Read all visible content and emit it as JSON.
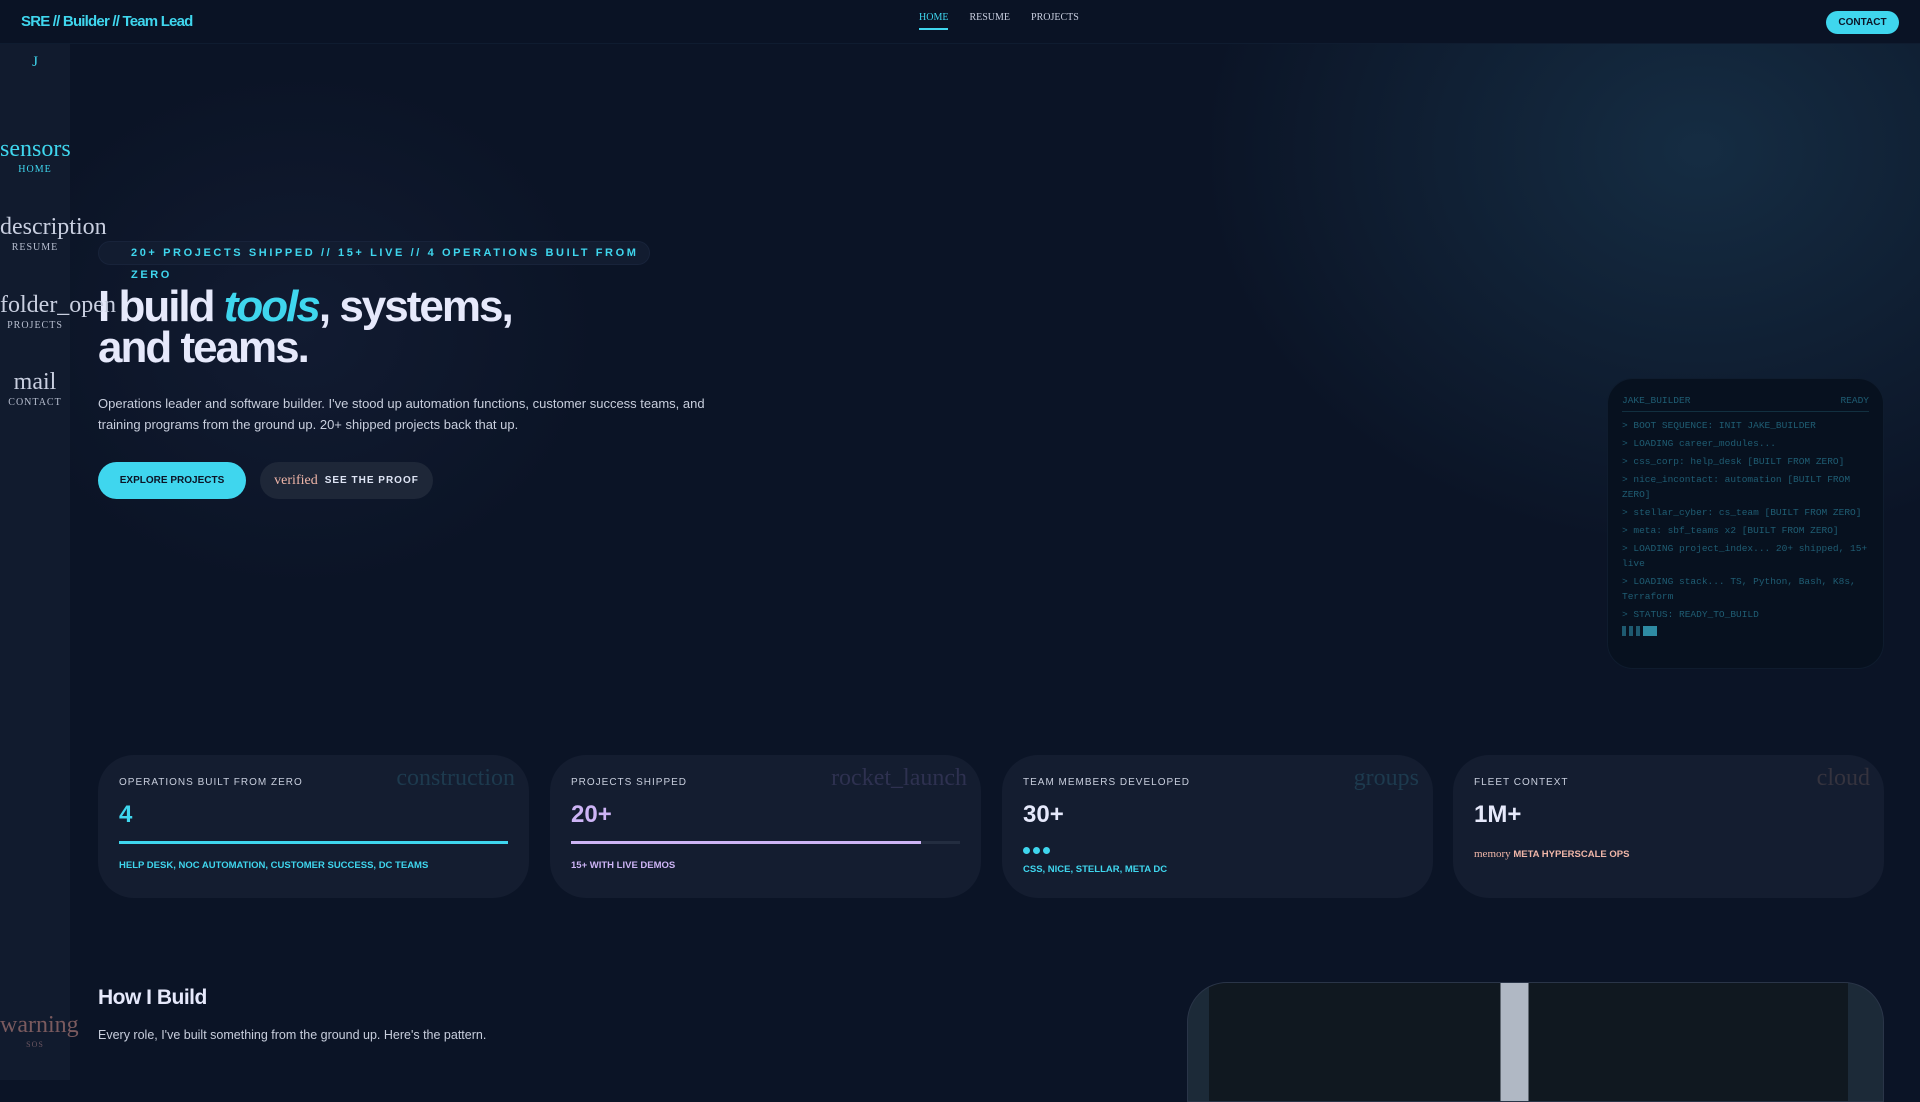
{
  "header": {
    "brand": "SRE // Builder // Team Lead",
    "nav": [
      "HOME",
      "RESUME",
      "PROJECTS"
    ],
    "contact": "CONTACT"
  },
  "sidebar": {
    "logo": "J",
    "items": [
      {
        "icon": "sensors",
        "label": "HOME"
      },
      {
        "icon": "description",
        "label": "RESUME"
      },
      {
        "icon": "folder_open",
        "label": "PROJECTS"
      },
      {
        "icon": "mail",
        "label": "CONTACT"
      }
    ],
    "sos": {
      "icon": "warning",
      "label": "SOS"
    }
  },
  "hero": {
    "badge": "20+ PROJECTS SHIPPED // 15+ LIVE // 4 OPERATIONS BUILT FROM ZERO",
    "title_a": "I build ",
    "title_em": "tools",
    "title_b": ", systems,",
    "title_c": "and teams.",
    "lead": "Operations leader and software builder. I've stood up automation functions, customer success teams, and training programs from the ground up. 20+ shipped projects back that up.",
    "explore": "EXPLORE PROJECTS",
    "proof_icon": "verified",
    "proof": "SEE THE PROOF"
  },
  "terminal": {
    "title": "JAKE_BUILDER",
    "status": "READY",
    "lines": [
      "> BOOT SEQUENCE: INIT JAKE_BUILDER",
      "> LOADING career_modules...",
      ">  css_corp: help_desk [BUILT FROM ZERO]",
      ">  nice_incontact: automation [BUILT FROM ZERO]",
      ">  stellar_cyber: cs_team [BUILT FROM ZERO]",
      ">  meta: sbf_teams x2 [BUILT FROM ZERO]",
      "> LOADING project_index... 20+ shipped, 15+ live",
      "> LOADING stack... TS, Python, Bash, K8s, Terraform",
      "> STATUS: READY_TO_BUILD"
    ]
  },
  "stats": [
    {
      "title": "OPERATIONS BUILT FROM ZERO",
      "icon": "construction",
      "value": "4",
      "progress": 1.0,
      "sub": "HELP DESK, NOC AUTOMATION, CUSTOMER SUCCESS, DC TEAMS"
    },
    {
      "title": "PROJECTS SHIPPED",
      "icon": "rocket_launch",
      "value": "20+",
      "progress": 0.9,
      "sub": "15+ WITH LIVE DEMOS"
    },
    {
      "title": "TEAM MEMBERS DEVELOPED",
      "icon": "groups",
      "value": "30+",
      "sub": "CSS, NICE, STELLAR, META DC"
    },
    {
      "title": "FLEET CONTEXT",
      "icon": "cloud",
      "value": "1M+",
      "sub_icon": "memory",
      "sub": "META HYPERSCALE OPS"
    }
  ],
  "how": {
    "title": "How I Build",
    "sub": "Every role, I've built something from the ground up. Here's the pattern."
  },
  "colors": {
    "accent": "#3fd6ee",
    "purple": "#cdb4f5",
    "salmon": "#f0b6a8",
    "bg": "#0b1426"
  }
}
